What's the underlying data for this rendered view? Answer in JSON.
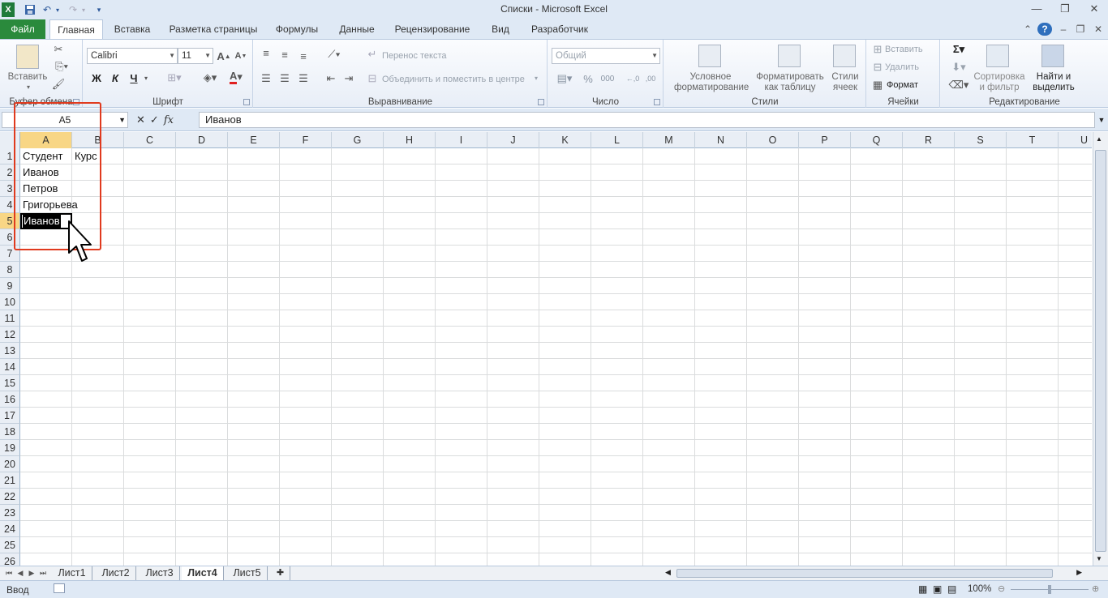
{
  "title": "Списки  -  Microsoft Excel",
  "tabs": {
    "file": "Файл",
    "items": [
      "Главная",
      "Вставка",
      "Разметка страницы",
      "Формулы",
      "Данные",
      "Рецензирование",
      "Вид",
      "Разработчик"
    ]
  },
  "ribbon": {
    "clipboard": {
      "label": "Буфер обмена",
      "paste": "Вставить"
    },
    "font": {
      "label": "Шрифт",
      "name": "Calibri",
      "size": "11",
      "bold": "Ж",
      "italic": "К",
      "underline": "Ч"
    },
    "alignment": {
      "label": "Выравнивание",
      "wrap": "Перенос текста",
      "merge": "Объединить и поместить в центре"
    },
    "number": {
      "label": "Число",
      "format": "Общий",
      "percent": "%",
      "thousands": "000"
    },
    "styles": {
      "label": "Стили",
      "conditional": "Условное форматирование",
      "as_table": "Форматировать как таблицу",
      "cell_styles": "Стили ячеек"
    },
    "cells": {
      "label": "Ячейки",
      "insert": "Вставить",
      "delete": "Удалить",
      "format": "Формат"
    },
    "editing": {
      "label": "Редактирование",
      "sort": "Сортировка и фильтр",
      "find": "Найти и выделить"
    }
  },
  "formula_bar": {
    "name_box": "A5",
    "fx": "fx",
    "value": "Иванов"
  },
  "columns": [
    "A",
    "B",
    "C",
    "D",
    "E",
    "F",
    "G",
    "H",
    "I",
    "J",
    "K",
    "L",
    "M",
    "N",
    "O",
    "P",
    "Q",
    "R",
    "S",
    "T",
    "U"
  ],
  "rows": [
    "1",
    "2",
    "3",
    "4",
    "5",
    "6",
    "7",
    "8",
    "9",
    "10",
    "11",
    "12",
    "13",
    "14",
    "15",
    "16",
    "17",
    "18",
    "19",
    "20",
    "21",
    "22",
    "23",
    "24",
    "25",
    "26"
  ],
  "cells": {
    "A1": "Студент",
    "B1": "Курс",
    "A2": "Иванов",
    "A3": "Петров",
    "A4": "Григорьева",
    "A5_editing": "Иванов"
  },
  "sheets": [
    "Лист1",
    "Лист2",
    "Лист3",
    "Лист4",
    "Лист5"
  ],
  "active_sheet": "Лист4",
  "status": {
    "mode": "Ввод",
    "zoom": "100%"
  },
  "colors": {
    "accent_green": "#2a8a3c",
    "selection_header": "#f8d685",
    "highlight_frame": "#e03a1e"
  }
}
